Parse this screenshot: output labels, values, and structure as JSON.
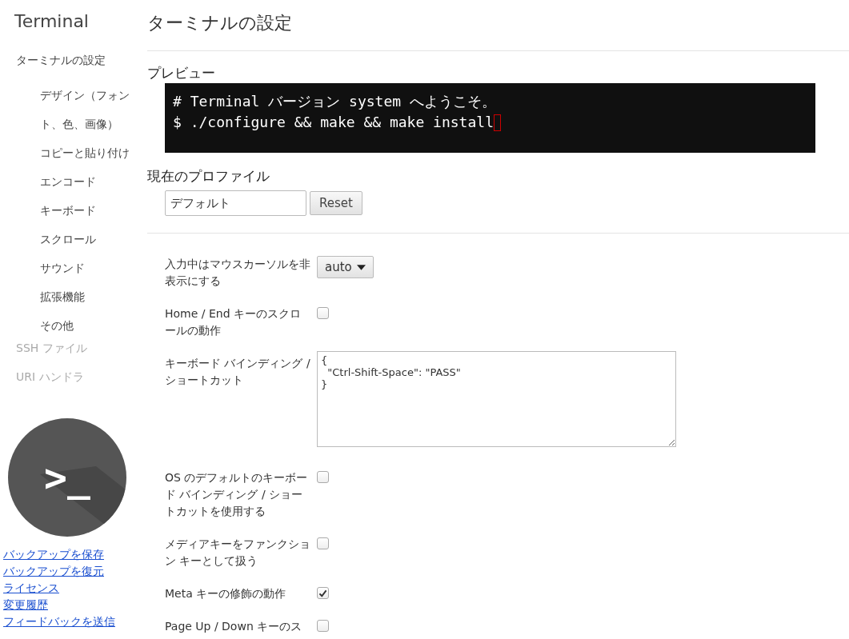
{
  "sidebar": {
    "title": "Terminal",
    "items": [
      {
        "label": "ターミナルの設定",
        "selected": true,
        "children": [
          {
            "label": "デザイン（フォント、色、画像）"
          },
          {
            "label": "コピーと貼り付け"
          },
          {
            "label": "エンコード"
          },
          {
            "label": "キーボード"
          },
          {
            "label": "スクロール"
          },
          {
            "label": "サウンド"
          },
          {
            "label": "拡張機能"
          },
          {
            "label": "その他"
          }
        ]
      },
      {
        "label": "SSH ファイル",
        "selected": false
      },
      {
        "label": "URI ハンドラ",
        "selected": false
      }
    ],
    "logo_glyph": ">_",
    "links": [
      "バックアップを保存",
      "バックアップを復元",
      "ライセンス",
      "変更履歴",
      "フィードバックを送信"
    ]
  },
  "page_title": "ターミナルの設定",
  "preview": {
    "heading": "プレビュー",
    "lines": [
      "# Terminal バージョン system へようこそ。",
      "$ ./configure && make && make install"
    ]
  },
  "profile": {
    "heading": "現在のプロファイル",
    "value": "デフォルト",
    "button": "Reset"
  },
  "settings": [
    {
      "kind": "select",
      "label": "入力中はマウスカーソルを非表示にする",
      "value": "auto"
    },
    {
      "kind": "checkbox",
      "label": "Home / End キーのスクロールの動作",
      "checked": false
    },
    {
      "kind": "textarea",
      "label": "キーボード バインディング / ショートカット",
      "value": "{\n  \"Ctrl-Shift-Space\": \"PASS\"\n}"
    },
    {
      "kind": "checkbox",
      "label": "OS のデフォルトのキーボード バインディング / ショートカットを使用する",
      "checked": false
    },
    {
      "kind": "checkbox",
      "label": "メディアキーをファンクション キーとして扱う",
      "checked": false
    },
    {
      "kind": "checkbox",
      "label": "Meta キーの修飾の動作",
      "checked": true
    },
    {
      "kind": "checkbox",
      "label": "Page Up / Down キーのス",
      "checked": false
    }
  ]
}
